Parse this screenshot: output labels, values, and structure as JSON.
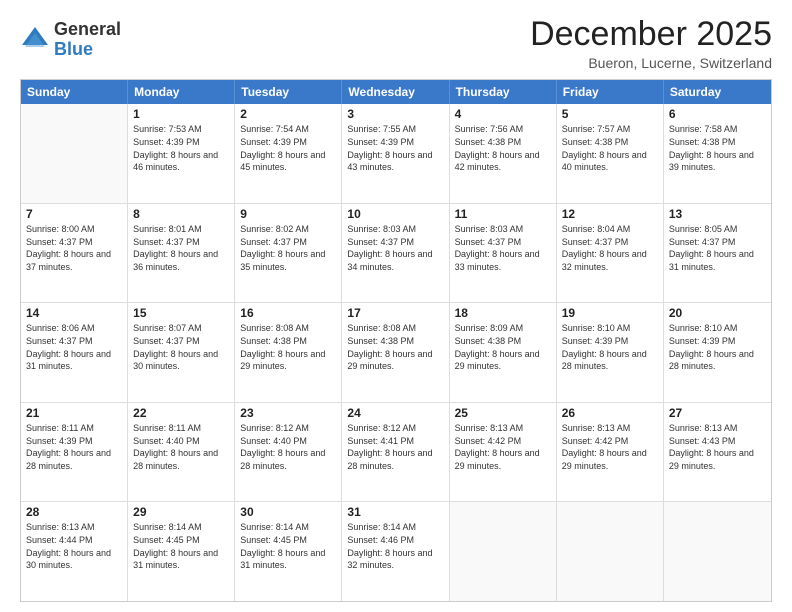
{
  "logo": {
    "general": "General",
    "blue": "Blue"
  },
  "title": "December 2025",
  "location": "Bueron, Lucerne, Switzerland",
  "days_of_week": [
    "Sunday",
    "Monday",
    "Tuesday",
    "Wednesday",
    "Thursday",
    "Friday",
    "Saturday"
  ],
  "weeks": [
    [
      {
        "day": "",
        "empty": true
      },
      {
        "day": "1",
        "sunrise": "7:53 AM",
        "sunset": "4:39 PM",
        "daylight": "8 hours and 46 minutes."
      },
      {
        "day": "2",
        "sunrise": "7:54 AM",
        "sunset": "4:39 PM",
        "daylight": "8 hours and 45 minutes."
      },
      {
        "day": "3",
        "sunrise": "7:55 AM",
        "sunset": "4:39 PM",
        "daylight": "8 hours and 43 minutes."
      },
      {
        "day": "4",
        "sunrise": "7:56 AM",
        "sunset": "4:38 PM",
        "daylight": "8 hours and 42 minutes."
      },
      {
        "day": "5",
        "sunrise": "7:57 AM",
        "sunset": "4:38 PM",
        "daylight": "8 hours and 40 minutes."
      },
      {
        "day": "6",
        "sunrise": "7:58 AM",
        "sunset": "4:38 PM",
        "daylight": "8 hours and 39 minutes."
      }
    ],
    [
      {
        "day": "7",
        "sunrise": "8:00 AM",
        "sunset": "4:37 PM",
        "daylight": "8 hours and 37 minutes."
      },
      {
        "day": "8",
        "sunrise": "8:01 AM",
        "sunset": "4:37 PM",
        "daylight": "8 hours and 36 minutes."
      },
      {
        "day": "9",
        "sunrise": "8:02 AM",
        "sunset": "4:37 PM",
        "daylight": "8 hours and 35 minutes."
      },
      {
        "day": "10",
        "sunrise": "8:03 AM",
        "sunset": "4:37 PM",
        "daylight": "8 hours and 34 minutes."
      },
      {
        "day": "11",
        "sunrise": "8:03 AM",
        "sunset": "4:37 PM",
        "daylight": "8 hours and 33 minutes."
      },
      {
        "day": "12",
        "sunrise": "8:04 AM",
        "sunset": "4:37 PM",
        "daylight": "8 hours and 32 minutes."
      },
      {
        "day": "13",
        "sunrise": "8:05 AM",
        "sunset": "4:37 PM",
        "daylight": "8 hours and 31 minutes."
      }
    ],
    [
      {
        "day": "14",
        "sunrise": "8:06 AM",
        "sunset": "4:37 PM",
        "daylight": "8 hours and 31 minutes."
      },
      {
        "day": "15",
        "sunrise": "8:07 AM",
        "sunset": "4:37 PM",
        "daylight": "8 hours and 30 minutes."
      },
      {
        "day": "16",
        "sunrise": "8:08 AM",
        "sunset": "4:38 PM",
        "daylight": "8 hours and 29 minutes."
      },
      {
        "day": "17",
        "sunrise": "8:08 AM",
        "sunset": "4:38 PM",
        "daylight": "8 hours and 29 minutes."
      },
      {
        "day": "18",
        "sunrise": "8:09 AM",
        "sunset": "4:38 PM",
        "daylight": "8 hours and 29 minutes."
      },
      {
        "day": "19",
        "sunrise": "8:10 AM",
        "sunset": "4:39 PM",
        "daylight": "8 hours and 28 minutes."
      },
      {
        "day": "20",
        "sunrise": "8:10 AM",
        "sunset": "4:39 PM",
        "daylight": "8 hours and 28 minutes."
      }
    ],
    [
      {
        "day": "21",
        "sunrise": "8:11 AM",
        "sunset": "4:39 PM",
        "daylight": "8 hours and 28 minutes."
      },
      {
        "day": "22",
        "sunrise": "8:11 AM",
        "sunset": "4:40 PM",
        "daylight": "8 hours and 28 minutes."
      },
      {
        "day": "23",
        "sunrise": "8:12 AM",
        "sunset": "4:40 PM",
        "daylight": "8 hours and 28 minutes."
      },
      {
        "day": "24",
        "sunrise": "8:12 AM",
        "sunset": "4:41 PM",
        "daylight": "8 hours and 28 minutes."
      },
      {
        "day": "25",
        "sunrise": "8:13 AM",
        "sunset": "4:42 PM",
        "daylight": "8 hours and 29 minutes."
      },
      {
        "day": "26",
        "sunrise": "8:13 AM",
        "sunset": "4:42 PM",
        "daylight": "8 hours and 29 minutes."
      },
      {
        "day": "27",
        "sunrise": "8:13 AM",
        "sunset": "4:43 PM",
        "daylight": "8 hours and 29 minutes."
      }
    ],
    [
      {
        "day": "28",
        "sunrise": "8:13 AM",
        "sunset": "4:44 PM",
        "daylight": "8 hours and 30 minutes."
      },
      {
        "day": "29",
        "sunrise": "8:14 AM",
        "sunset": "4:45 PM",
        "daylight": "8 hours and 31 minutes."
      },
      {
        "day": "30",
        "sunrise": "8:14 AM",
        "sunset": "4:45 PM",
        "daylight": "8 hours and 31 minutes."
      },
      {
        "day": "31",
        "sunrise": "8:14 AM",
        "sunset": "4:46 PM",
        "daylight": "8 hours and 32 minutes."
      },
      {
        "day": "",
        "empty": true
      },
      {
        "day": "",
        "empty": true
      },
      {
        "day": "",
        "empty": true
      }
    ]
  ]
}
